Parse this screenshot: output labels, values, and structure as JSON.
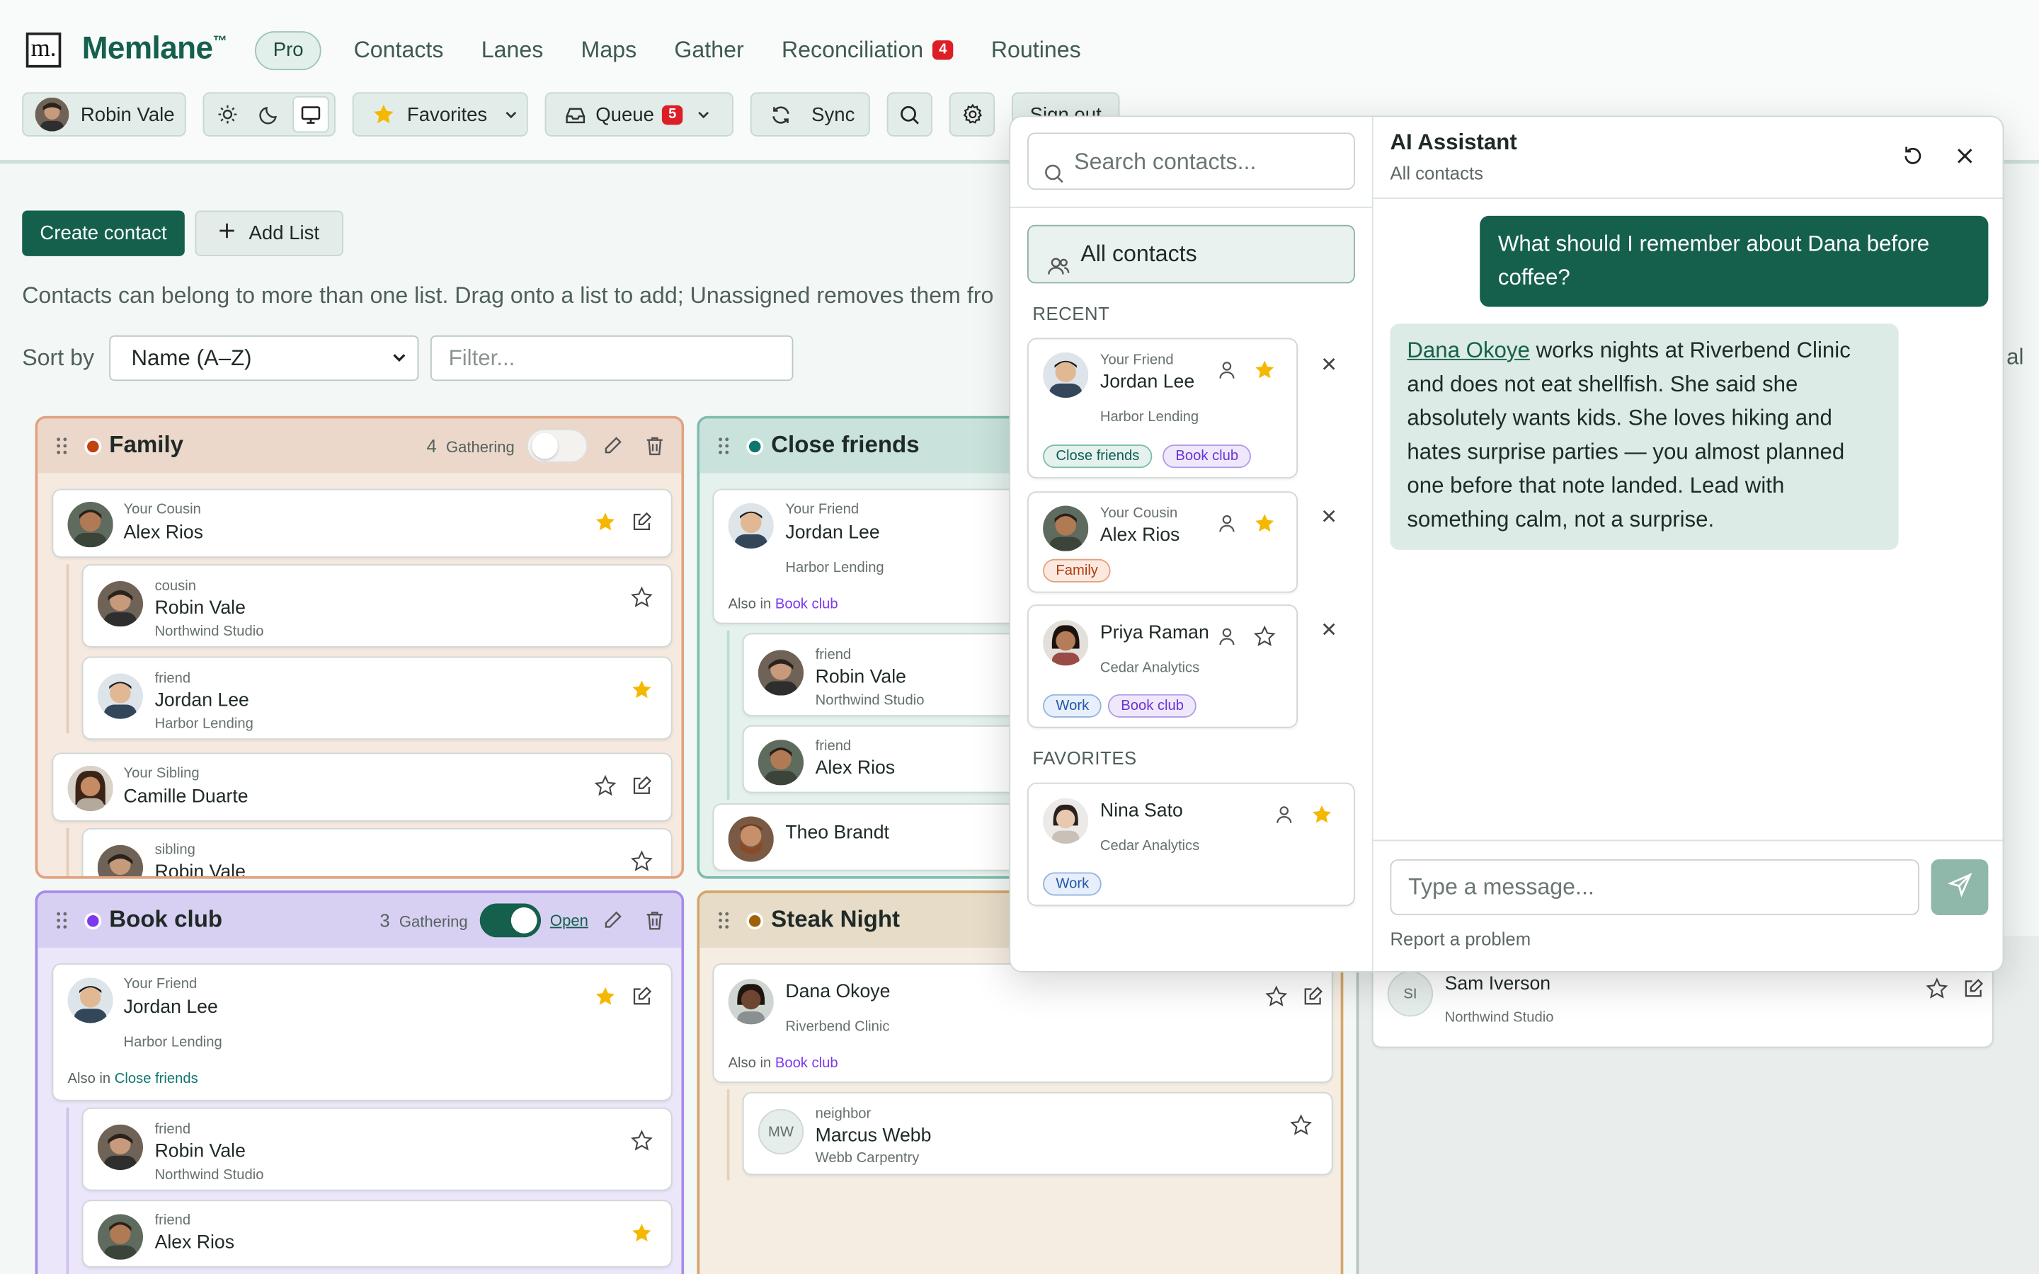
{
  "app": {
    "logo_letter": "m.",
    "name": "Memlane",
    "trademark": "™",
    "plan_badge": "Pro"
  },
  "nav": [
    {
      "label": "Contacts"
    },
    {
      "label": "Lanes"
    },
    {
      "label": "Maps"
    },
    {
      "label": "Gather"
    },
    {
      "label": "Reconciliation",
      "badge": "4"
    },
    {
      "label": "Routines"
    }
  ],
  "toolbar": {
    "user_name": "Robin Vale",
    "favorites_label": "Favorites",
    "queue_label": "Queue",
    "queue_count": "5",
    "sync_label": "Sync",
    "signout_label": "Sign out"
  },
  "actions": {
    "create_contact": "Create contact",
    "add_list": "Add List",
    "help_text": "Contacts can belong to more than one list. Drag onto a list to add; Unassigned removes them fro",
    "sort_label": "Sort by",
    "sort_value": "Name (A–Z)",
    "filter_placeholder": "Filter..."
  },
  "lanes": {
    "family": {
      "title": "Family",
      "count": "4",
      "gathering_label": "Gathering",
      "color": "#c2410c",
      "cards": [
        {
          "rel": "Your Cousin",
          "name": "Alex Rios"
        },
        {
          "rel": "cousin",
          "name": "Robin Vale",
          "org": "Northwind Studio"
        },
        {
          "rel": "friend",
          "name": "Jordan Lee",
          "org": "Harbor Lending"
        },
        {
          "rel": "Your Sibling",
          "name": "Camille Duarte"
        },
        {
          "rel": "sibling",
          "name": "Robin Vale"
        }
      ]
    },
    "close_friends": {
      "title": "Close friends",
      "color": "#0f766e",
      "cards": [
        {
          "rel": "Your Friend",
          "name": "Jordan Lee",
          "org": "Harbor Lending",
          "also_prefix": "Also in",
          "also_list": "Book club"
        },
        {
          "rel": "friend",
          "name": "Robin Vale",
          "org": "Northwind Studio"
        },
        {
          "rel": "friend",
          "name": "Alex Rios"
        },
        {
          "name": "Theo Brandt"
        }
      ]
    },
    "book_club": {
      "title": "Book club",
      "count": "3",
      "gathering_label": "Gathering",
      "open_label": "Open",
      "color": "#7c3aed",
      "cards": [
        {
          "rel": "Your Friend",
          "name": "Jordan Lee",
          "org": "Harbor Lending",
          "also_prefix": "Also in",
          "also_list": "Close friends"
        },
        {
          "rel": "friend",
          "name": "Robin Vale",
          "org": "Northwind Studio"
        },
        {
          "rel": "friend",
          "name": "Alex Rios"
        }
      ]
    },
    "steak_night": {
      "title": "Steak Night",
      "color": "#a16207",
      "cards": [
        {
          "name": "Dana Okoye",
          "org": "Riverbend Clinic",
          "also_prefix": "Also in",
          "also_list": "Book club"
        },
        {
          "rel": "neighbor",
          "name": "Marcus Webb",
          "org": "Webb Carpentry",
          "initials": "MW"
        }
      ]
    },
    "unassigned": {
      "cards": [
        {
          "name": "Sam Iverson",
          "org": "Northwind Studio",
          "initials": "SI"
        }
      ],
      "edge_text": "al"
    }
  },
  "picker": {
    "search_placeholder": "Search contacts...",
    "all_contacts": "All contacts",
    "recent_label": "RECENT",
    "favorites_label": "FAVORITES",
    "recent": [
      {
        "rel": "Your Friend",
        "name": "Jordan Lee",
        "org": "Harbor Lending",
        "tags": [
          "Close friends",
          "Book club"
        ]
      },
      {
        "rel": "Your Cousin",
        "name": "Alex Rios",
        "tags": [
          "Family"
        ]
      },
      {
        "name": "Priya Raman",
        "org": "Cedar Analytics",
        "tags": [
          "Work",
          "Book club"
        ]
      }
    ],
    "favorites": [
      {
        "name": "Nina Sato",
        "org": "Cedar Analytics",
        "tags": [
          "Work"
        ]
      }
    ]
  },
  "assistant": {
    "title": "AI Assistant",
    "subtitle": "All contacts",
    "user_message": "What should I remember about Dana before coffee?",
    "reply_name": "Dana Okoye",
    "reply_text": " works nights at Riverbend Clinic and does not eat shellfish. She said she absolutely wants kids. She loves hiking and hates surprise parties — you almost planned one before that note landed. Lead with something calm, not a surprise.",
    "input_placeholder": "Type a message...",
    "report_link": "Report a problem"
  },
  "colors": {
    "brand": "#15604d",
    "alert": "#dc1f26",
    "star": "#f5b800"
  }
}
